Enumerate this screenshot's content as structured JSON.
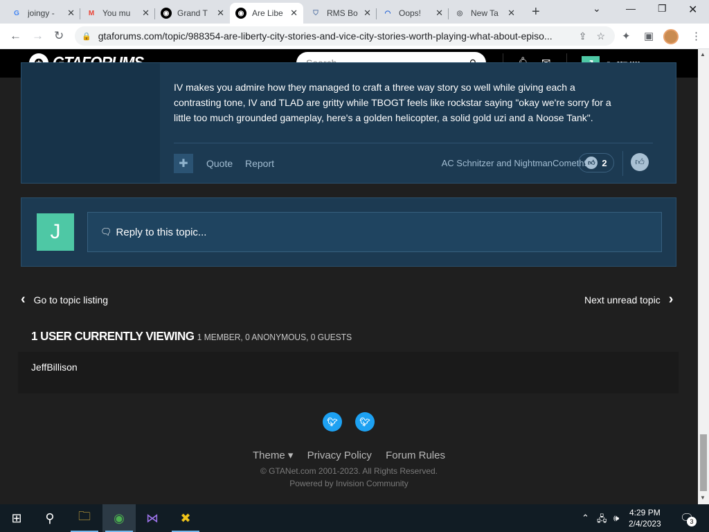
{
  "browser": {
    "tabs": [
      {
        "title": "joingy -",
        "favicon": "G",
        "color": "#4285f4"
      },
      {
        "title": "You mu",
        "favicon": "M",
        "color": "#ea4335"
      },
      {
        "title": "Grand T",
        "favicon": "gtaforums-icon",
        "color": "#000000"
      },
      {
        "title": "Are Libe",
        "favicon": "gtaforums-icon",
        "color": "#000000"
      },
      {
        "title": "RMS Bo",
        "favicon": "shield-icon",
        "color": "#5a78a6"
      },
      {
        "title": "Oops!",
        "favicon": "swirl-icon",
        "color": "#1e5fd6"
      },
      {
        "title": "New Ta",
        "favicon": "chrome-icon",
        "color": "#5f6368"
      }
    ],
    "url": "gtaforums.com/topic/988354-are-liberty-city-stories-and-vice-city-stories-worth-playing-what-about-episo..."
  },
  "site": {
    "logo_text": "GTAFORUMS",
    "search_placeholder": "Search...",
    "username": "JeffBillison",
    "avatar_letter": "J"
  },
  "post": {
    "lines": [
      "IV makes you admire how they managed to craft a three way story so well while giving each a",
      "contrasting tone, IV and TLAD are gritty while TBOGT feels like rockstar saying \"okay we're sorry for a",
      "little too much grounded gameplay, here's a golden helicopter, a solid gold uzi and a Noose Tank\"."
    ],
    "quote_label": "Quote",
    "report_label": "Report",
    "likers": "AC Schnitzer and NightmanCometh96",
    "like_count": "2"
  },
  "reply": {
    "avatar_letter": "J",
    "placeholder": "Reply to this topic..."
  },
  "nav": {
    "prev": "Go to topic listing",
    "next": "Next unread topic"
  },
  "viewing": {
    "title": "1 USER CURRENTLY VIEWING",
    "subtitle": "1 MEMBER, 0 ANONYMOUS, 0 GUESTS",
    "users": [
      "JeffBillison"
    ]
  },
  "footer": {
    "links": [
      "Theme ▾",
      "Privacy Policy",
      "Forum Rules"
    ],
    "copyright": "© GTANet.com 2001-2023. All Rights Reserved.",
    "powered": "Powered by Invision Community"
  },
  "taskbar": {
    "time": "4:29 PM",
    "date": "2/4/2023",
    "notifications": "3"
  },
  "colors": {
    "post_bg": "#1c3a52",
    "accent_avatar": "#4ec8a5",
    "twitter": "#1da1f2"
  }
}
